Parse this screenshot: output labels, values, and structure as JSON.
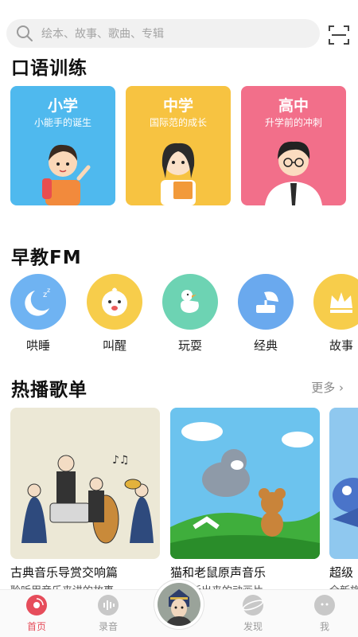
{
  "search": {
    "placeholder": "绘本、故事、歌曲、专辑"
  },
  "sections": {
    "oral": "口语训练",
    "fm": "早教FM",
    "playlists": "热播歌单",
    "more": "更多"
  },
  "levels": [
    {
      "title": "小学",
      "subtitle": "小能手的诞生",
      "color": "#4fb9ee"
    },
    {
      "title": "中学",
      "subtitle": "国际范的成长",
      "color": "#f7c341"
    },
    {
      "title": "高中",
      "subtitle": "升学前的冲刺",
      "color": "#f26f8a"
    }
  ],
  "fm": [
    {
      "label": "哄睡",
      "icon": "moon-sleep-icon",
      "color": "#6fb3f2"
    },
    {
      "label": "叫醒",
      "icon": "baby-face-icon",
      "color": "#f7cd4b"
    },
    {
      "label": "玩耍",
      "icon": "duck-icon",
      "color": "#6dd3b3"
    },
    {
      "label": "经典",
      "icon": "gramophone-icon",
      "color": "#6aa9ee"
    },
    {
      "label": "故事",
      "icon": "crown-icon",
      "color": "#f7cd4b"
    }
  ],
  "playlists": [
    {
      "title": "古典音乐导赏交响篇",
      "subtitle": "聆听用音乐来讲的故事"
    },
    {
      "title": "猫和老鼠原声音乐",
      "subtitle": "一起听出来的动画片"
    },
    {
      "title": "超级",
      "subtitle": "全新旅"
    }
  ],
  "nav": [
    {
      "label": "首页",
      "icon": "home-disc-icon"
    },
    {
      "label": "录音",
      "icon": "mic-wave-icon"
    },
    {
      "label": "发现",
      "icon": "planet-icon"
    },
    {
      "label": "我",
      "icon": "profile-icon"
    }
  ],
  "colors": {
    "accent": "#e64d5b",
    "nav_inactive": "#9b9b9b"
  }
}
